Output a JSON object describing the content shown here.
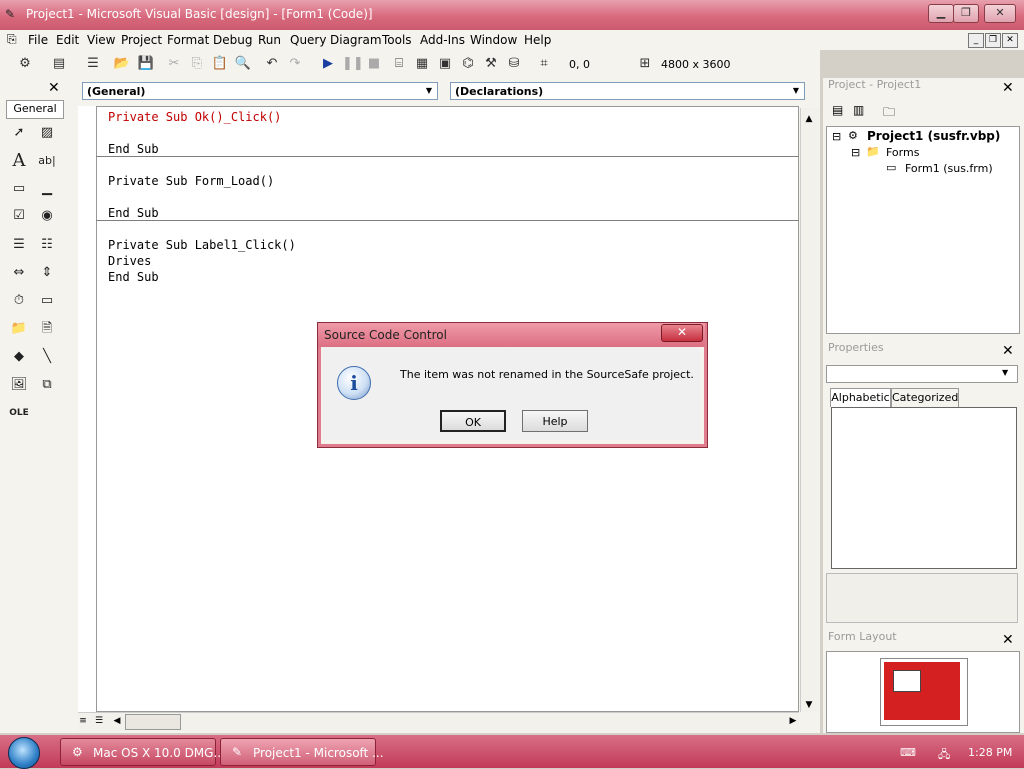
{
  "window": {
    "title": "Project1 - Microsoft Visual Basic [design] - [Form1 (Code)]"
  },
  "menu": [
    "File",
    "Edit",
    "View",
    "Project",
    "Format",
    "Debug",
    "Run",
    "Query",
    "Diagram",
    "Tools",
    "Add-Ins",
    "Window",
    "Help"
  ],
  "toolbar": {
    "position": "0, 0",
    "size": "4800 x 3600"
  },
  "toolbox": {
    "tab_label": "General"
  },
  "code_window": {
    "object_combo": "(General)",
    "procedure_combo": "(Declarations)",
    "procedures": [
      {
        "lines": [
          "Private Sub Ok()_Click()",
          "",
          "End Sub"
        ]
      },
      {
        "lines": [
          "Private Sub Form_Load()",
          "",
          "End Sub"
        ]
      },
      {
        "lines": [
          "Private Sub Label1_Click()",
          "Drives",
          "End Sub"
        ]
      }
    ]
  },
  "project_explorer": {
    "title": "Project - Project1",
    "root": "Project1 (susfr.vbp)",
    "folder": "Forms",
    "item": "Form1 (sus.frm)"
  },
  "properties": {
    "title": "Properties",
    "tabs": [
      "Alphabetic",
      "Categorized"
    ]
  },
  "form_layout": {
    "title": "Form Layout"
  },
  "dialog": {
    "title": "Source Code Control",
    "message": "The item was not renamed in the SourceSafe project.",
    "ok_label": "OK",
    "help_label": "Help",
    "close_glyph": "✕",
    "icon": "info-icon"
  },
  "taskbar": {
    "items": [
      "Mac OS X 10.0 DMG...",
      "Project1 - Microsoft ..."
    ],
    "clock": "1:28 PM"
  },
  "colors": {
    "accent": "#d86a7e",
    "code_keyword_red": "#c00000"
  }
}
